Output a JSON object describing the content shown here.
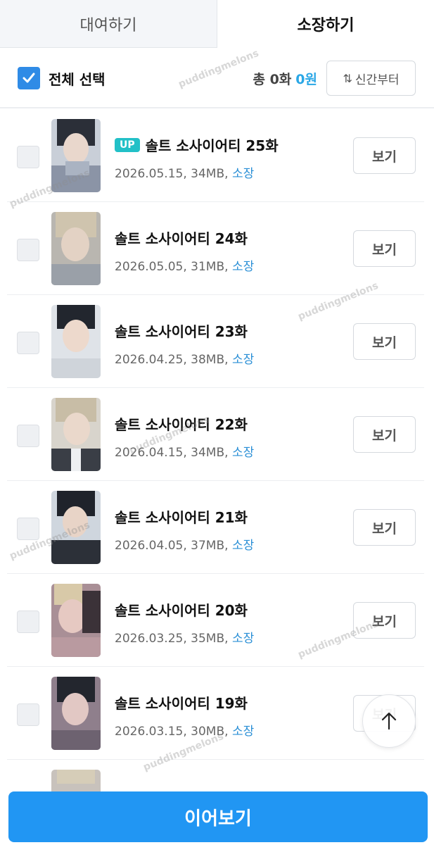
{
  "tabs": [
    {
      "label": "대여하기",
      "active": false
    },
    {
      "label": "소장하기",
      "active": true
    }
  ],
  "toolbar": {
    "select_all_label": "전체 선택",
    "select_all_checked": true,
    "total_count": "총 0화",
    "total_price": "0원",
    "sort_label": "신간부터",
    "sort_icon": "sort-arrows-icon"
  },
  "episodes": [
    {
      "badge": "UP",
      "title": "솔트 소사이어티 25화",
      "date": "2026.05.15",
      "size": "34MB",
      "status": "소장",
      "button": "보기"
    },
    {
      "badge": "",
      "title": "솔트 소사이어티 24화",
      "date": "2026.05.05",
      "size": "31MB",
      "status": "소장",
      "button": "보기"
    },
    {
      "badge": "",
      "title": "솔트 소사이어티 23화",
      "date": "2026.04.25",
      "size": "38MB",
      "status": "소장",
      "button": "보기"
    },
    {
      "badge": "",
      "title": "솔트 소사이어티 22화",
      "date": "2026.04.15",
      "size": "34MB",
      "status": "소장",
      "button": "보기"
    },
    {
      "badge": "",
      "title": "솔트 소사이어티 21화",
      "date": "2026.04.05",
      "size": "37MB",
      "status": "소장",
      "button": "보기"
    },
    {
      "badge": "",
      "title": "솔트 소사이어티 20화",
      "date": "2026.03.25",
      "size": "35MB",
      "status": "소장",
      "button": "보기"
    },
    {
      "badge": "",
      "title": "솔트 소사이어티 19화",
      "date": "2026.03.15",
      "size": "30MB",
      "status": "소장",
      "button": "보기"
    }
  ],
  "continue_button": "이어보기",
  "watermark": "puddingmelons",
  "colors": {
    "accent_blue": "#2196f3",
    "checkbox_blue": "#2f8be6",
    "price_blue": "#2aa7e6",
    "own_blue": "#2a8fd6",
    "up_badge": "#22c0c7"
  }
}
